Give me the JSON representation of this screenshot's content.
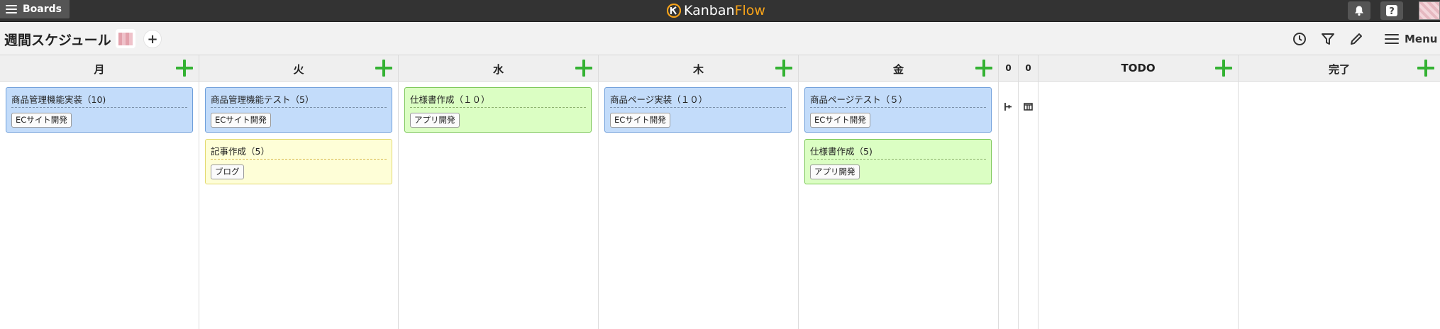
{
  "topbar": {
    "boards_label": "Boards",
    "logo_part1": "Kanban",
    "logo_part2": "Flow",
    "notification_icon": "bell-icon",
    "help_icon": "question-icon",
    "brand_orange": "#f5a21a",
    "bar_color": "#333333"
  },
  "board": {
    "title": "週間スケジュール",
    "add_member_label": "+",
    "tools": [
      "clock-icon",
      "filter-icon",
      "pencil-icon"
    ],
    "menu_label": "Menu"
  },
  "columns": [
    {
      "name": "月",
      "cards": [
        {
          "title": "商品管理機能実装（10)",
          "tag": "ECサイト開発",
          "color": "blue"
        }
      ]
    },
    {
      "name": "火",
      "cards": [
        {
          "title": "商品管理機能テスト（5）",
          "tag": "ECサイト開発",
          "color": "blue"
        },
        {
          "title": "記事作成（5）",
          "tag": "ブログ",
          "color": "yellow"
        }
      ]
    },
    {
      "name": "水",
      "cards": [
        {
          "title": "仕様書作成（１０）",
          "tag": "アプリ開発",
          "color": "green"
        }
      ]
    },
    {
      "name": "木",
      "cards": [
        {
          "title": "商品ページ実装（１０）",
          "tag": "ECサイト開発",
          "color": "blue"
        }
      ]
    },
    {
      "name": "金",
      "cards": [
        {
          "title": "商品ページテスト（５）",
          "tag": "ECサイト開発",
          "color": "blue"
        },
        {
          "title": "仕様書作成（5)",
          "tag": "アプリ開発",
          "color": "green"
        }
      ]
    },
    {
      "name": "TODO",
      "cards": []
    },
    {
      "name": "完了",
      "cards": []
    }
  ],
  "collapsed_columns": [
    {
      "count": "0",
      "icon": "split-columns-icon"
    },
    {
      "count": "0",
      "icon": "expand-columns-icon"
    }
  ],
  "colors": {
    "add_green": "#34b233",
    "card_blue": "#c3dcfa",
    "card_yellow": "#fefed7",
    "card_green": "#dbfec3"
  }
}
